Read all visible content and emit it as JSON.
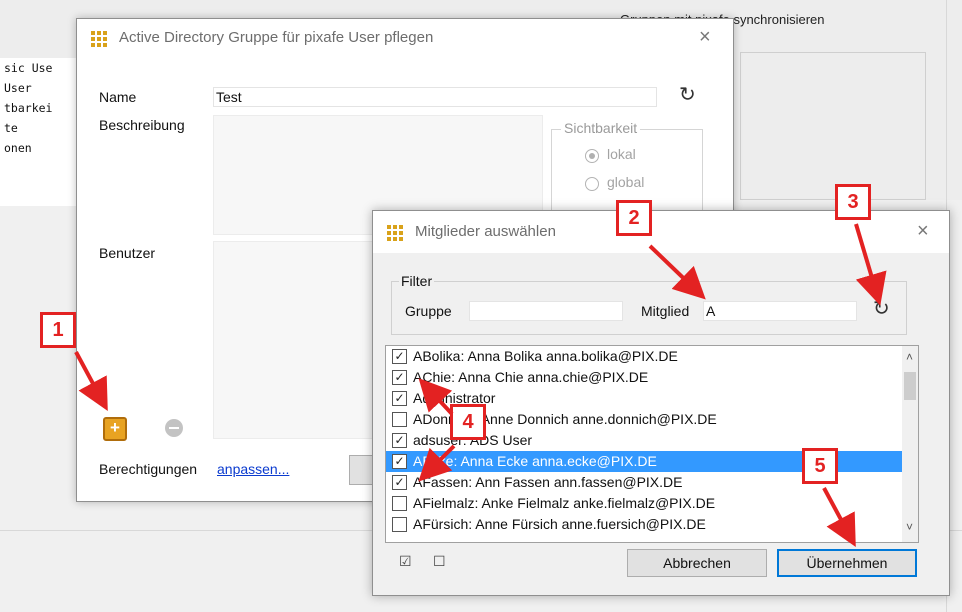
{
  "background": {
    "list_items": [
      "sic Use",
      "User",
      "tbarkei",
      "te",
      "onen"
    ],
    "sync_label": "Gruppen mit pixafe synchronisieren"
  },
  "dialog1": {
    "title": "Active Directory Gruppe für pixafe User pflegen",
    "name_label": "Name",
    "name_value": "Test",
    "description_label": "Beschreibung",
    "visibility_group_label": "Sichtbarkeit",
    "visibility_options": [
      "lokal",
      "global"
    ],
    "users_label": "Benutzer",
    "permissions_label": "Berechtigungen",
    "permissions_link": "anpassen..."
  },
  "dialog2": {
    "title": "Mitglieder auswählen",
    "filter_label": "Filter",
    "group_label": "Gruppe",
    "group_value": "",
    "member_label": "Mitglied",
    "member_value": "A",
    "members": [
      {
        "text": "ABolika: Anna Bolika anna.bolika@PIX.DE",
        "checked": true,
        "selected": false
      },
      {
        "text": "AChie: Anna Chie anna.chie@PIX.DE",
        "checked": true,
        "selected": false
      },
      {
        "text": "Administrator",
        "checked": true,
        "selected": false
      },
      {
        "text": "ADonnich: Anne Donnich anne.donnich@PIX.DE",
        "checked": false,
        "selected": false
      },
      {
        "text": "adsuser: ADS User",
        "checked": true,
        "selected": false
      },
      {
        "text": "AEcke: Anna Ecke anna.ecke@PIX.DE",
        "checked": true,
        "selected": true
      },
      {
        "text": "AFassen: Ann Fassen ann.fassen@PIX.DE",
        "checked": true,
        "selected": false
      },
      {
        "text": "AFielmalz: Anke Fielmalz anke.fielmalz@PIX.DE",
        "checked": false,
        "selected": false
      },
      {
        "text": "AFürsich: Anne Fürsich anne.fuersich@PIX.DE",
        "checked": false,
        "selected": false
      }
    ],
    "cancel_label": "Abbrechen",
    "apply_label": "Übernehmen",
    "check_all_glyph": "☑",
    "uncheck_all_glyph": "☐"
  },
  "callouts": [
    "1",
    "2",
    "3",
    "4",
    "5"
  ],
  "colors": {
    "callout_red": "#e32222",
    "selection_blue": "#3399ff",
    "app_icon_gold": "#d9a21a",
    "link_blue": "#0b3bcf"
  },
  "icons": {
    "close": "×",
    "refresh": "↻",
    "add": "+",
    "scroll_up": "˄",
    "scroll_down": "˅"
  }
}
